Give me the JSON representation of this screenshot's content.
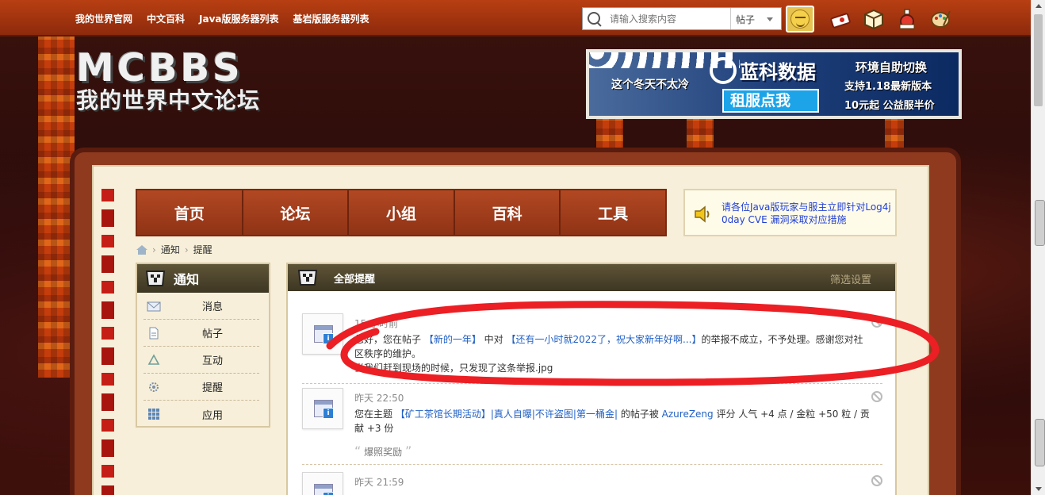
{
  "topnav": {
    "links": [
      "我的世界官网",
      "中文百科",
      "Java版服务器列表",
      "基岩版服务器列表"
    ]
  },
  "search": {
    "placeholder": "请输入搜索内容",
    "scope": "帖子"
  },
  "logo": {
    "title": "MCBBS",
    "subtitle": "我的世界中文论坛"
  },
  "ad": {
    "tagline": "这个冬天不太冷",
    "brand": "蓝科数据",
    "button": "租服点我",
    "lines": [
      "环境自助切换",
      "支持1.18最新版本",
      "10元起 公益服半价"
    ]
  },
  "mainnav": [
    "首页",
    "论坛",
    "小组",
    "百科",
    "工具"
  ],
  "announcement": {
    "text": "请各位Java版玩家与服主立即针对Log4j 0day CVE 漏洞采取对应措施"
  },
  "breadcrumb": [
    "通知",
    "提醒"
  ],
  "sidebar": {
    "title": "通知",
    "items": [
      {
        "label": "消息",
        "icon": "envelope-icon"
      },
      {
        "label": "帖子",
        "icon": "document-icon"
      },
      {
        "label": "互动",
        "icon": "recycle-icon"
      },
      {
        "label": "提醒",
        "icon": "gear-icon"
      },
      {
        "label": "应用",
        "icon": "grid-icon"
      }
    ]
  },
  "notices": {
    "title": "全部提醒",
    "filter": "筛选设置",
    "items": [
      {
        "time": "15 小时前",
        "pre": "您好，您在帖子 ",
        "link1": "【新的一年】",
        "mid": " 中对 ",
        "link2": "【还有一小时就2022了，祝大家新年好啊...】",
        "post": "的举报不成立，不予处理。感谢您对社区秩序的维护。",
        "extra": "当我们赶到现场的时候，只发现了这条举报.jpg"
      },
      {
        "time": "昨天 22:50",
        "pre": "您在主题 ",
        "link1": "【矿工茶馆长期活动】|真人自曝|不许盗图|第一桶金|",
        "mid": " 的帖子被 ",
        "link2": "AzureZeng",
        "post": " 评分 人气 +4 点 / 金粒 +50 粒 / 贡献 +3 份",
        "quote": "爆照奖励"
      },
      {
        "time": "昨天 21:59"
      }
    ]
  },
  "colors": {
    "topbar": "#a8370f",
    "nav": "#9e3b1a",
    "link": "#2160c4",
    "highlight": "#e8262a"
  }
}
